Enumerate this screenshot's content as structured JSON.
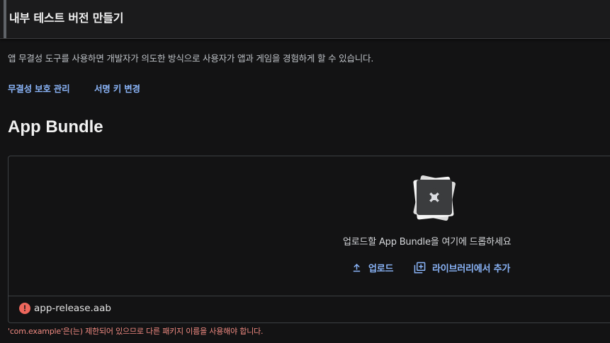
{
  "header": {
    "title": "내부 테스트 버전 만들기"
  },
  "integrity": {
    "description": "앱 무결성 도구를 사용하면 개발자가 의도한 방식으로 사용자가 앱과 게임을 경험하게 할 수 있습니다.",
    "manage_protection_link": "무결성 보호 관리",
    "change_signing_key_link": "서명 키 변경"
  },
  "app_bundle": {
    "heading": "App Bundle",
    "drop_prompt": "업로드할 App Bundle을 여기에 드롭하세요",
    "upload_label": "업로드",
    "add_from_library_label": "라이브러리에서 추가",
    "bundle_graphic_icon": "app-bundle-icon",
    "upload_icon": "upload-icon",
    "library_icon": "add-from-library-icon"
  },
  "uploaded_file": {
    "status_icon": "error-icon",
    "name": "app-release.aab",
    "error": "'com.example'은(는) 제한되어 있으므로 다른 패키지 이름을 사용해야 합니다."
  },
  "colors": {
    "background": "#131314",
    "link": "#8ab4f8",
    "error": "#f28b82"
  }
}
